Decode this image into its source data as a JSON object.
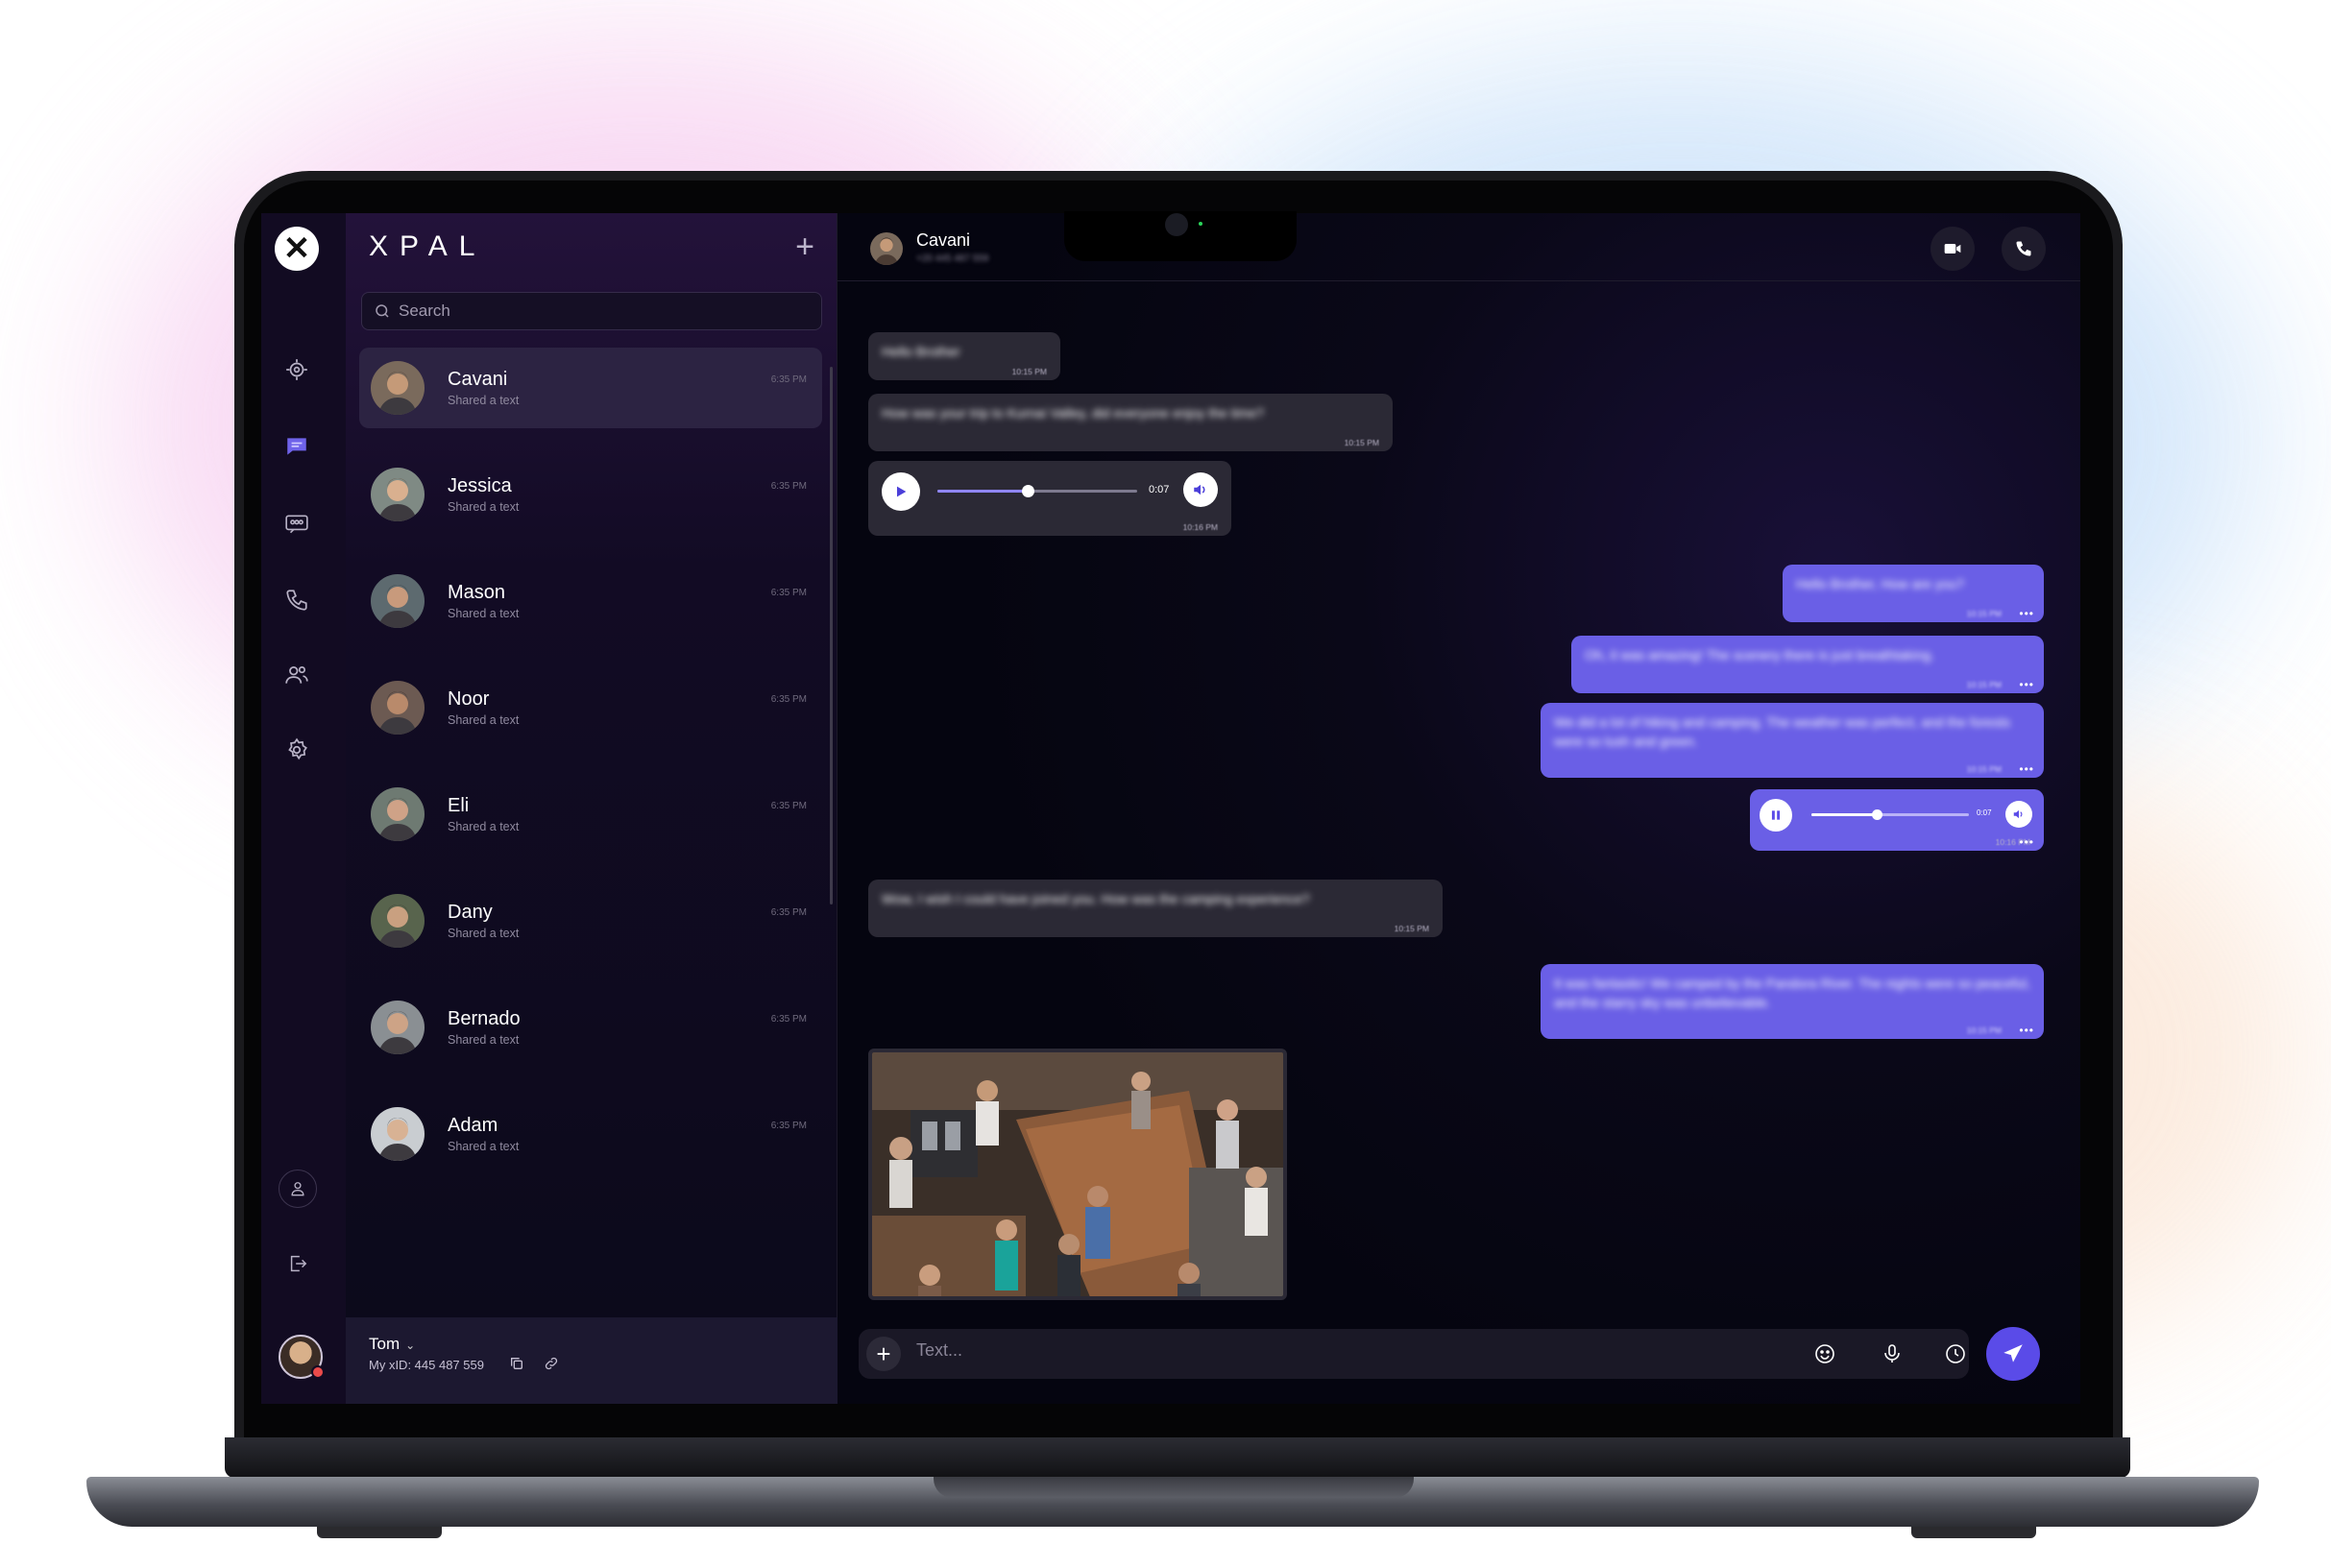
{
  "app": {
    "brand": "XPAL"
  },
  "search": {
    "placeholder": "Search"
  },
  "contacts": [
    {
      "name": "Cavani",
      "sub": "Shared a text",
      "time": "6:35 PM",
      "active": true,
      "skin": "#c59a78",
      "hair": "#3a2a20",
      "bg": "#7a6a5c"
    },
    {
      "name": "Jessica",
      "sub": "Shared a text",
      "time": "6:35 PM",
      "skin": "#d9b08f",
      "hair": "#5a3d2a",
      "bg": "#7f8a84"
    },
    {
      "name": "Mason",
      "sub": "Shared a text",
      "time": "6:35 PM",
      "skin": "#c89a7c",
      "hair": "#20262a",
      "bg": "#5d6a6f"
    },
    {
      "name": "Noor",
      "sub": "Shared a text",
      "time": "6:35 PM",
      "skin": "#b98a6b",
      "hair": "#1e1512",
      "bg": "#6c5a52"
    },
    {
      "name": "Eli",
      "sub": "Shared a text",
      "time": "6:35 PM",
      "skin": "#cfa287",
      "hair": "#3b2b20",
      "bg": "#6e7a72"
    },
    {
      "name": "Dany",
      "sub": "Shared a text",
      "time": "6:35 PM",
      "skin": "#c9a080",
      "hair": "#2b2220",
      "bg": "#58644d"
    },
    {
      "name": "Bernado",
      "sub": "Shared a text",
      "time": "6:35 PM",
      "skin": "#cda386",
      "hair": "#2a2420",
      "bg": "#8a8f93"
    },
    {
      "name": "Adam",
      "sub": "Shared a text",
      "time": "6:35 PM",
      "skin": "#d8b294",
      "hair": "#1d1a18",
      "bg": "#c9cdd1"
    }
  ],
  "me": {
    "name": "Tom",
    "id_text": "My xID: 445 487 559"
  },
  "chat": {
    "contact_name": "Cavani",
    "contact_sub": "+20 445 487 559",
    "composer_placeholder": "Text...",
    "messages": {
      "m1": {
        "text": "Hello Brother",
        "time": "10:15 PM"
      },
      "m2": {
        "text": "How was your trip to Kurnai Valley, did everyone enjoy the time?",
        "time": "10:15 PM"
      },
      "a1": {
        "duration": "0:07",
        "time": "10:16 PM",
        "progress": 0.45
      },
      "m3": {
        "text": "Hello Brother, How are you?",
        "time": "10:15 PM"
      },
      "m4": {
        "text": "Oh, it was amazing! The scenery there is just breathtaking.",
        "time": "10:15 PM"
      },
      "m5": {
        "text": "We did a lot of hiking and camping. The weather was perfect, and the forests were so lush and green.",
        "time": "10:15 PM"
      },
      "a2": {
        "duration": "0:07",
        "time": "10:16 PM",
        "progress": 0.42
      },
      "m6": {
        "text": "Wow, I wish I could have joined you. How was the camping experience?",
        "time": "10:15 PM"
      },
      "m7": {
        "text": "It was fantastic! We camped by the Pandora River. The nights were so peaceful, and the starry sky was unbelievable.",
        "time": "10:15 PM"
      }
    }
  },
  "colors": {
    "accent": "#6a5fe6",
    "send": "#5a4be8",
    "incoming": "#2b2935",
    "sidebar_top": "#23123a"
  }
}
